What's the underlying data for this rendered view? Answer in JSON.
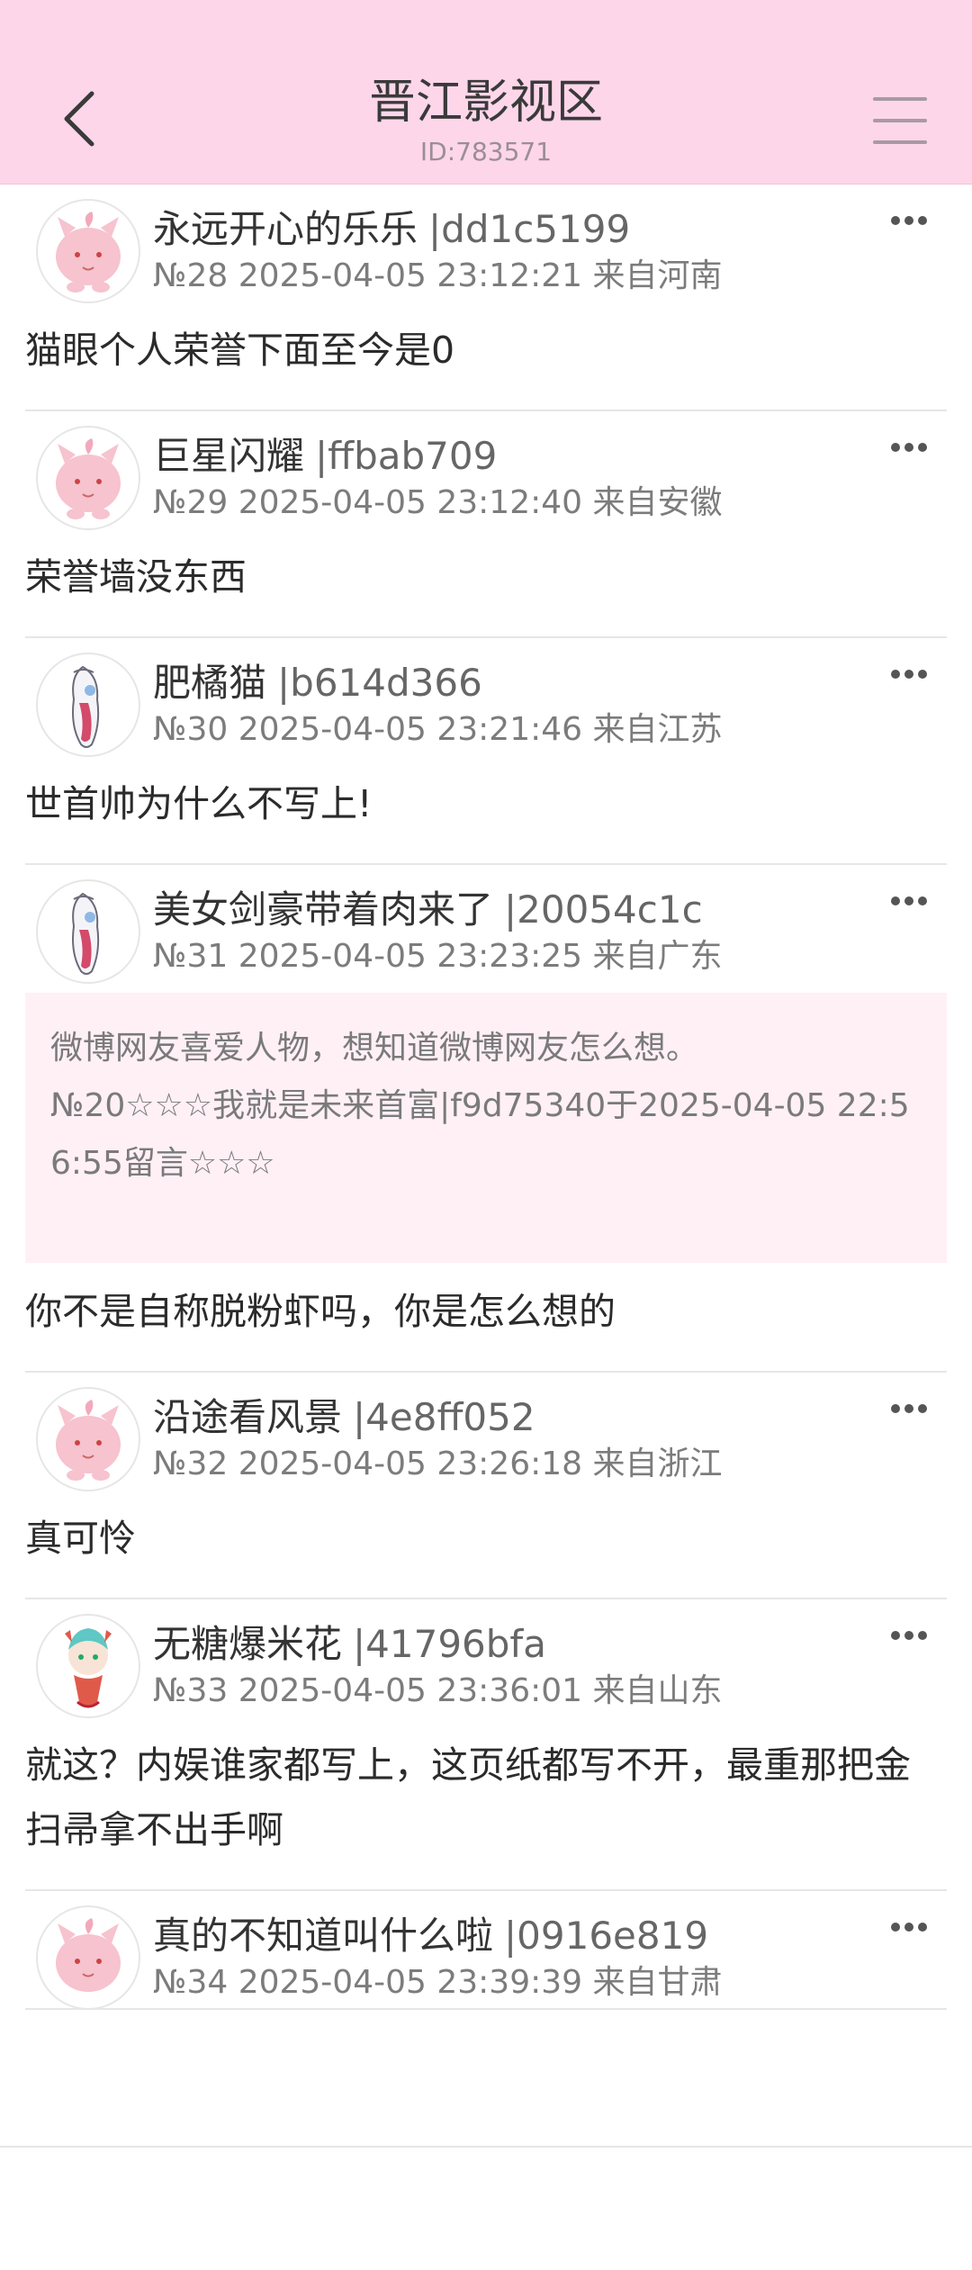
{
  "header": {
    "title": "晋江影视区",
    "subtitle": "ID:783571"
  },
  "posts": [
    {
      "name": "永远开心的乐乐",
      "uid": "|dd1c5199",
      "meta": "№28 2025-04-05 23:12:21 来自河南",
      "body": "猫眼个人荣誉下面至今是0",
      "avatar": "pink-creature"
    },
    {
      "name": "巨星闪耀",
      "uid": "|ffbab709",
      "meta": "№29 2025-04-05 23:12:40 来自安徽",
      "body": "荣誉墙没东西",
      "avatar": "pink-creature"
    },
    {
      "name": "肥橘猫",
      "uid": "|b614d366",
      "meta": "№30 2025-04-05 23:21:46 来自江苏",
      "body": "世首帅为什么不写上!",
      "avatar": "ribbon-creature"
    },
    {
      "name": "美女剑豪带着肉来了",
      "uid": "|20054c1c",
      "meta": "№31 2025-04-05 23:23:25 来自广东",
      "quote_line1": "微博网友喜爱人物，想知道微博网友怎么想。",
      "quote_line2": "№20☆☆☆我就是未来首富|f9d75340于2025-04-05 22:56:55留言☆☆☆",
      "body": "你不是自称脱粉虾吗，你是怎么想的",
      "avatar": "ribbon-creature"
    },
    {
      "name": "沿途看风景",
      "uid": "|4e8ff052",
      "meta": "№32 2025-04-05 23:26:18 来自浙江",
      "body": "真可怜",
      "avatar": "pink-creature"
    },
    {
      "name": "无糖爆米花",
      "uid": "|41796bfa",
      "meta": "№33 2025-04-05 23:36:01 来自山东",
      "body": "就这？内娱谁家都写上，这页纸都写不开，最重那把金扫帚拿不出手啊",
      "avatar": "mermaid-creature"
    },
    {
      "name": "真的不知道叫什么啦",
      "uid": "|0916e819",
      "meta": "№34 2025-04-05 23:39:39 来自甘肃",
      "body": "",
      "avatar": "pink-creature"
    }
  ],
  "colors": {
    "header_bg": "#fdd6ea",
    "quote_bg": "#fff0f6",
    "divider": "#e6e6e6"
  }
}
